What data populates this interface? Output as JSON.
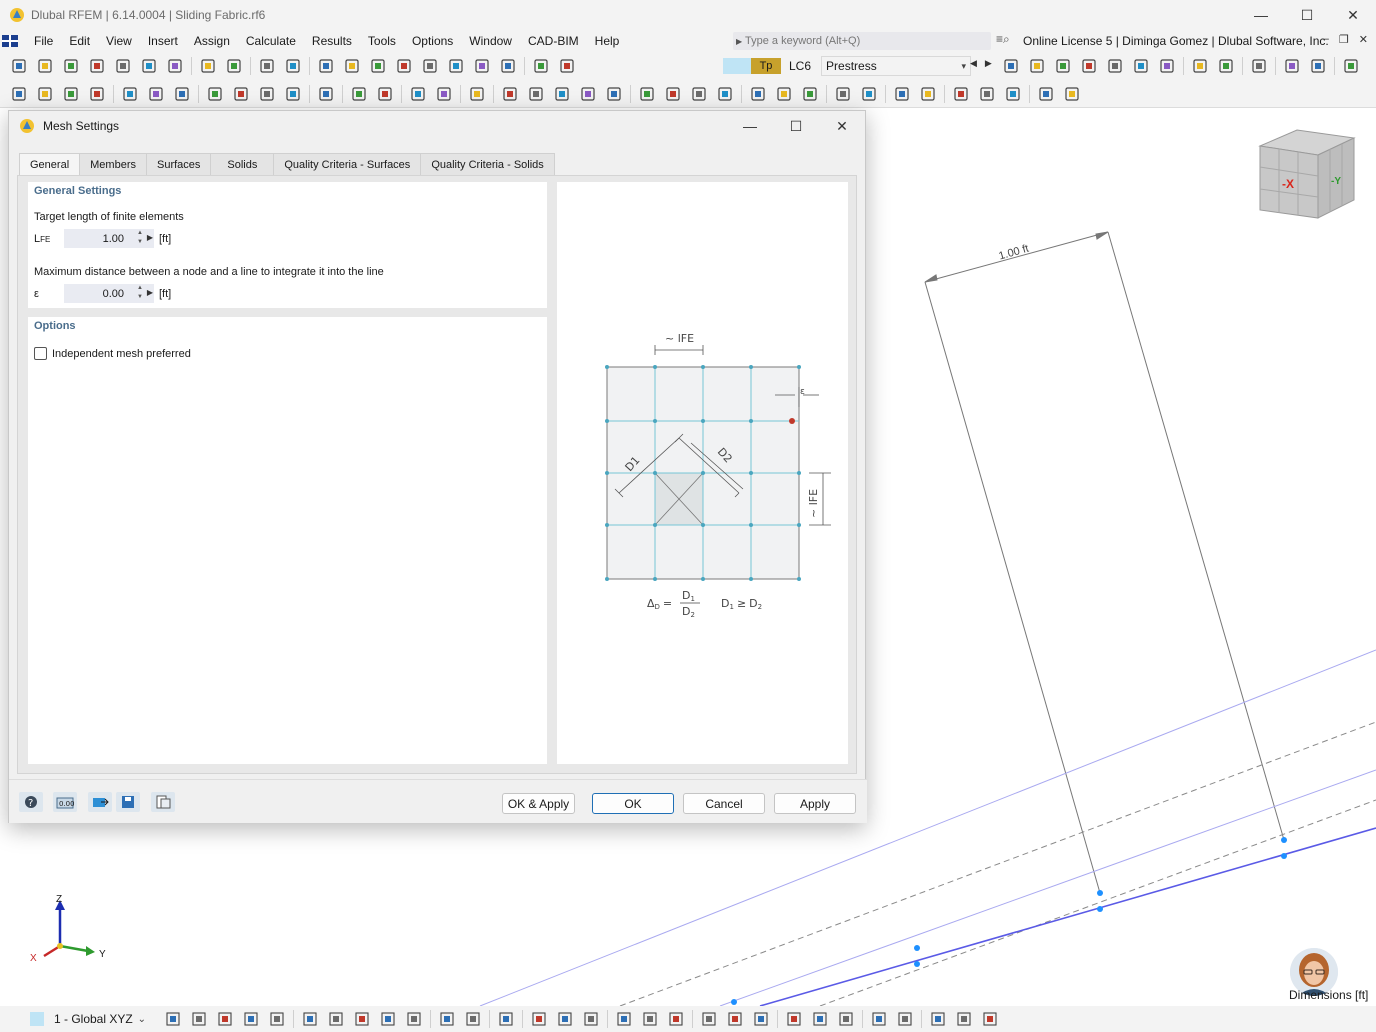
{
  "window": {
    "title": "Dlubal RFEM | 6.14.0004 | Sliding Fabric.rf6"
  },
  "menu": {
    "items": [
      "File",
      "Edit",
      "View",
      "Insert",
      "Assign",
      "Calculate",
      "Results",
      "Tools",
      "Options",
      "Window",
      "CAD-BIM",
      "Help"
    ],
    "search_placeholder": "Type a keyword (Alt+Q)",
    "license": "Online License 5 | Diminga Gomez | Dlubal Software, Inc."
  },
  "loadcase": {
    "type_tag": "Tp",
    "code": "LC6",
    "name": "Prestress"
  },
  "viewcube": {
    "x_label": "-X",
    "y_label": "-Y"
  },
  "viewport": {
    "dimension_label": "1.00 ft",
    "dimensions_caption": "Dimensions [ft]"
  },
  "axes": {
    "z": "Z",
    "x": "X",
    "y": "Y"
  },
  "statusbar": {
    "coordinate_system": "1 - Global XYZ"
  },
  "dialog": {
    "title": "Mesh Settings",
    "tabs": [
      "General",
      "Members",
      "Surfaces",
      "Solids",
      "Quality Criteria - Surfaces",
      "Quality Criteria - Solids"
    ],
    "general_settings": {
      "heading": "General Settings",
      "target_length_label": "Target length of finite elements",
      "lfe_symbol": "L",
      "lfe_subscript": "FE",
      "lfe_value": "1.00",
      "lfe_unit": "[ft]",
      "max_distance_label": "Maximum distance between a node and a line to integrate it into the line",
      "epsilon_symbol": "ε",
      "epsilon_value": "0.00",
      "epsilon_unit": "[ft]"
    },
    "options": {
      "heading": "Options",
      "independent_mesh_label": "Independent mesh preferred",
      "independent_mesh_checked": false
    },
    "diagram": {
      "lfe_top": "~ l",
      "lfe_sub": "FE",
      "lfe_side": "~ l",
      "epsilon": "ε",
      "d1": "D1",
      "d2": "D2",
      "formula_lhs": "Δ",
      "formula_lhs_sub": "D",
      "formula_eq": "=",
      "formula_num": "D",
      "formula_num_sub": "1",
      "formula_den": "D",
      "formula_den_sub": "2",
      "cond_d1": "D",
      "cond_d1_sub": "1",
      "cond_op": "≥",
      "cond_d2": "D",
      "cond_d2_sub": "2"
    },
    "buttons": {
      "ok_apply": "OK & Apply",
      "ok": "OK",
      "cancel": "Cancel",
      "apply": "Apply"
    }
  },
  "colors": {
    "accent": "#1f6fb5",
    "section_heading": "#4a6d8c",
    "mesh_line": "#6fbfcf",
    "member_line": "#5a5ae6",
    "loadcase_tag": "#c7a12c"
  }
}
